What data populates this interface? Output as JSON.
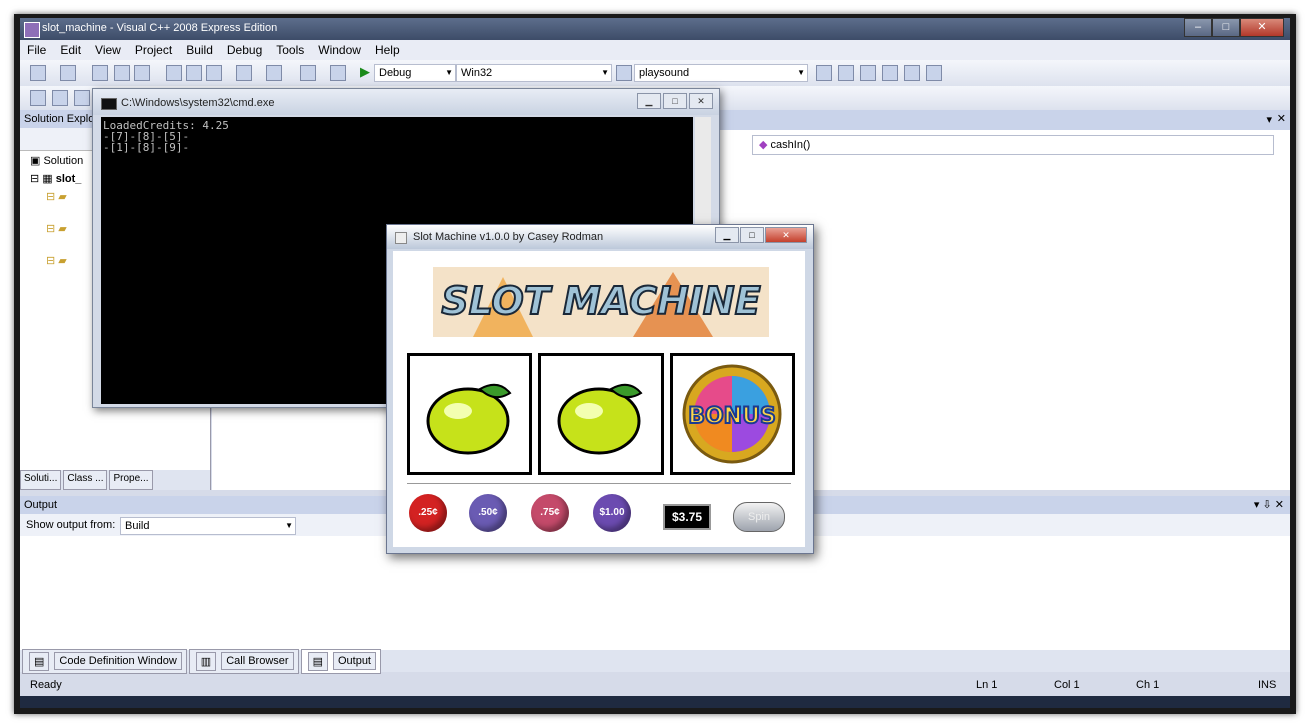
{
  "vs": {
    "title": "slot_machine - Visual C++ 2008 Express Edition",
    "menu": [
      "File",
      "Edit",
      "View",
      "Project",
      "Build",
      "Debug",
      "Tools",
      "Window",
      "Help"
    ],
    "toolbar": {
      "config": "Debug",
      "platform": "Win32",
      "find": "playsound"
    },
    "solution_explorer": {
      "title": "Solution Explo",
      "items": [
        "Solution",
        "slot_"
      ],
      "tabs": [
        "Soluti...",
        "Class ...",
        "Prope..."
      ]
    },
    "editor": {
      "member_combo": "cashIn()"
    },
    "output": {
      "title": "Output",
      "show_from_label": "Show output from:",
      "show_from_value": "Build"
    },
    "bottom_tabs": [
      "Code Definition Window",
      "Call Browser",
      "Output"
    ],
    "status": {
      "text": "Ready",
      "ln": "Ln 1",
      "col": "Col 1",
      "ch": "Ch 1",
      "ins": "INS"
    }
  },
  "cmd": {
    "title": "C:\\Windows\\system32\\cmd.exe",
    "lines": [
      "LoadedCredits: 4.25",
      "-[7]-[8]-[5]-",
      "-[1]-[8]-[9]-"
    ]
  },
  "slot": {
    "title": "Slot Machine v1.0.0 by Casey Rodman",
    "banner": "SLOT MACHINE",
    "reels": [
      "lemon",
      "lemon",
      "bonus"
    ],
    "bonus_text": "BONUS",
    "coins": [
      {
        "label": ".25¢",
        "color": "#d32222"
      },
      {
        "label": ".50¢",
        "color": "#6a5bb3"
      },
      {
        "label": ".75¢",
        "color": "#c44a6a"
      },
      {
        "label": "$1.00",
        "color": "#6b4bb0"
      }
    ],
    "credit": "$3.75",
    "spin": "Spin"
  }
}
